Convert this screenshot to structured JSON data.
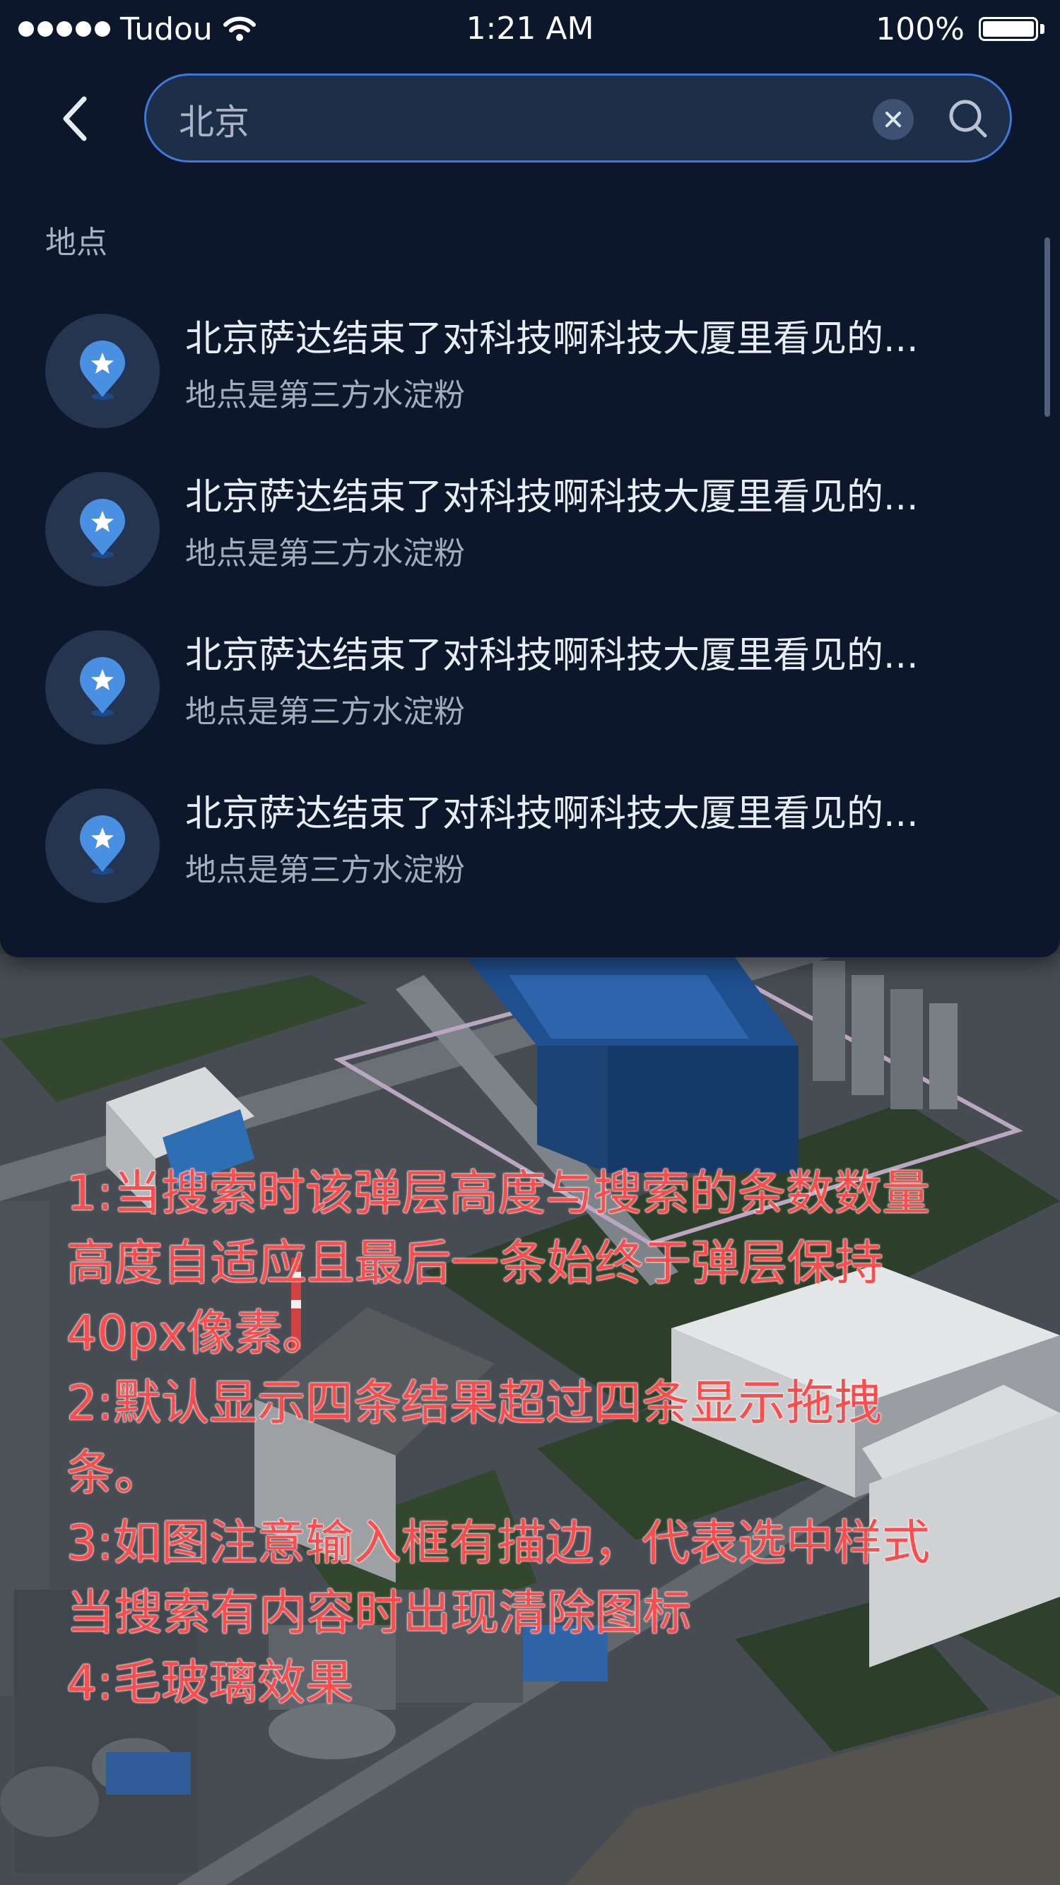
{
  "status_bar": {
    "carrier": "Tudou",
    "time": "1:21 AM",
    "battery": "100%"
  },
  "search": {
    "value": "北京",
    "placeholder": "北京",
    "back_icon": "chevron-left-icon",
    "clear_icon": "clear-icon",
    "search_icon": "search-icon"
  },
  "results": {
    "section_label": "地点",
    "items": [
      {
        "title": "北京萨达结束了对科技啊科技大厦里看见的...",
        "subtitle": "地点是第三方水淀粉",
        "icon": "location-pin-icon"
      },
      {
        "title": "北京萨达结束了对科技啊科技大厦里看见的...",
        "subtitle": "地点是第三方水淀粉",
        "icon": "location-pin-icon"
      },
      {
        "title": "北京萨达结束了对科技啊科技大厦里看见的...",
        "subtitle": "地点是第三方水淀粉",
        "icon": "location-pin-icon"
      },
      {
        "title": "北京萨达结束了对科技啊科技大厦里看见的...",
        "subtitle": "地点是第三方水淀粉",
        "icon": "location-pin-icon"
      }
    ]
  },
  "annotation": {
    "lines": [
      "1:当搜索时该弹层高度与搜索的条数数量",
      "高度自适应且最后一条始终于弹层保持",
      "40px像素。",
      "2:默认显示四条结果超过四条显示拖拽",
      "条。",
      "3:如图注意输入框有描边，代表选中样式",
      "当搜索有内容时出现清除图标",
      "4:毛玻璃效果"
    ]
  },
  "colors": {
    "panel": "#0a162a",
    "search_border": "#3f78d8",
    "pin": "#4a90e2",
    "annotation": "#ff4d4d"
  }
}
